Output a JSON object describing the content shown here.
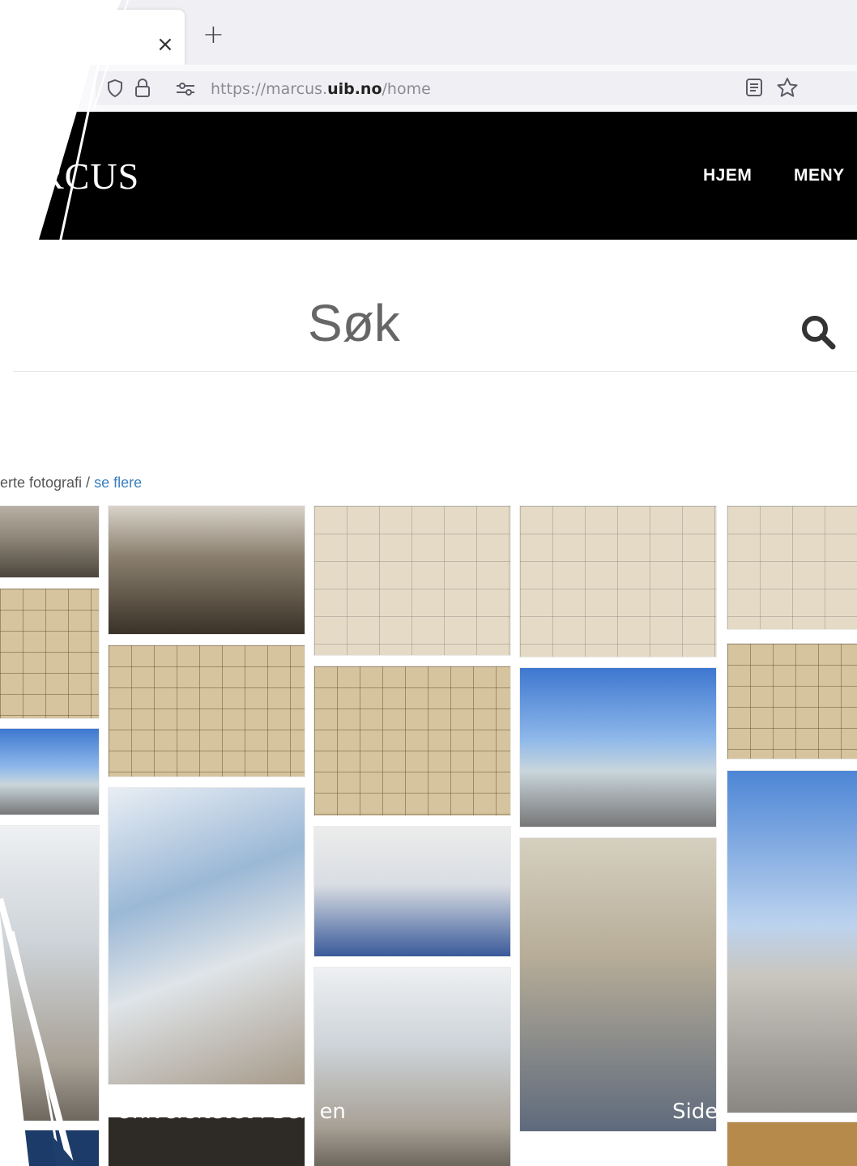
{
  "browser": {
    "tab_close": "×",
    "new_tab": "+",
    "url_prefix": "https://marcus.",
    "url_domain": "uib.no",
    "url_path": "/home"
  },
  "site": {
    "logo": "RCUS",
    "nav": [
      {
        "label": "HJEM"
      },
      {
        "label": "MENY"
      }
    ]
  },
  "search": {
    "label": "Søk"
  },
  "gallery": {
    "section_label": "erte fotografi /",
    "see_more": "se flere"
  },
  "slide_footer": {
    "left": "Universitetet i Ber",
    "left_tail": "en",
    "right": "Side"
  },
  "colors": {
    "header_bg": "#000000",
    "link": "#3a7fc0",
    "tab_bg": "#f0f0f4"
  }
}
